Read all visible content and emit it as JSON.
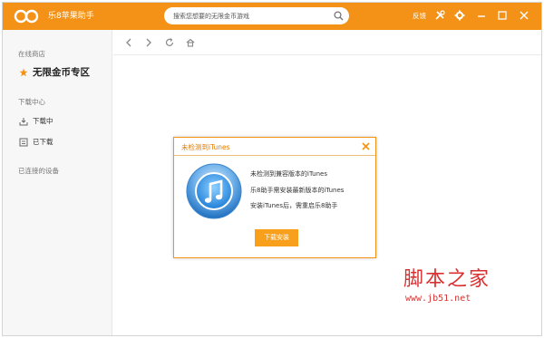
{
  "app": {
    "title": "乐8苹果助手",
    "search": {
      "placeholder": "搜索您想要的无限金币游戏",
      "value": ""
    },
    "feedback_label": "反馈",
    "icons": [
      "logo-icon",
      "search-icon",
      "tools-icon",
      "settings-icon",
      "minimize-icon",
      "maximize-icon",
      "close-icon"
    ]
  },
  "colors": {
    "accent": "#f39217",
    "button": "#f8a01c",
    "watermark": "#d93131"
  },
  "sidebar": {
    "store_header": "在线商店",
    "store_item": "无限金币专区",
    "download_header": "下载中心",
    "downloading": "下载中",
    "downloaded": "已下载",
    "devices_header": "已连接的设备"
  },
  "nav": {
    "icons": [
      "back-icon",
      "forward-icon",
      "refresh-icon",
      "home-icon"
    ]
  },
  "dialog": {
    "title": "未检测到iTunes",
    "line1": "未检测到兼容版本的iTunes",
    "line2": "乐8助手需安装最新版本的iTunes",
    "line3": "安装iTunes后，需重启乐8助手",
    "button": "下载安装"
  },
  "watermark": {
    "title": "脚本之家",
    "url": "www.jb51.net"
  }
}
